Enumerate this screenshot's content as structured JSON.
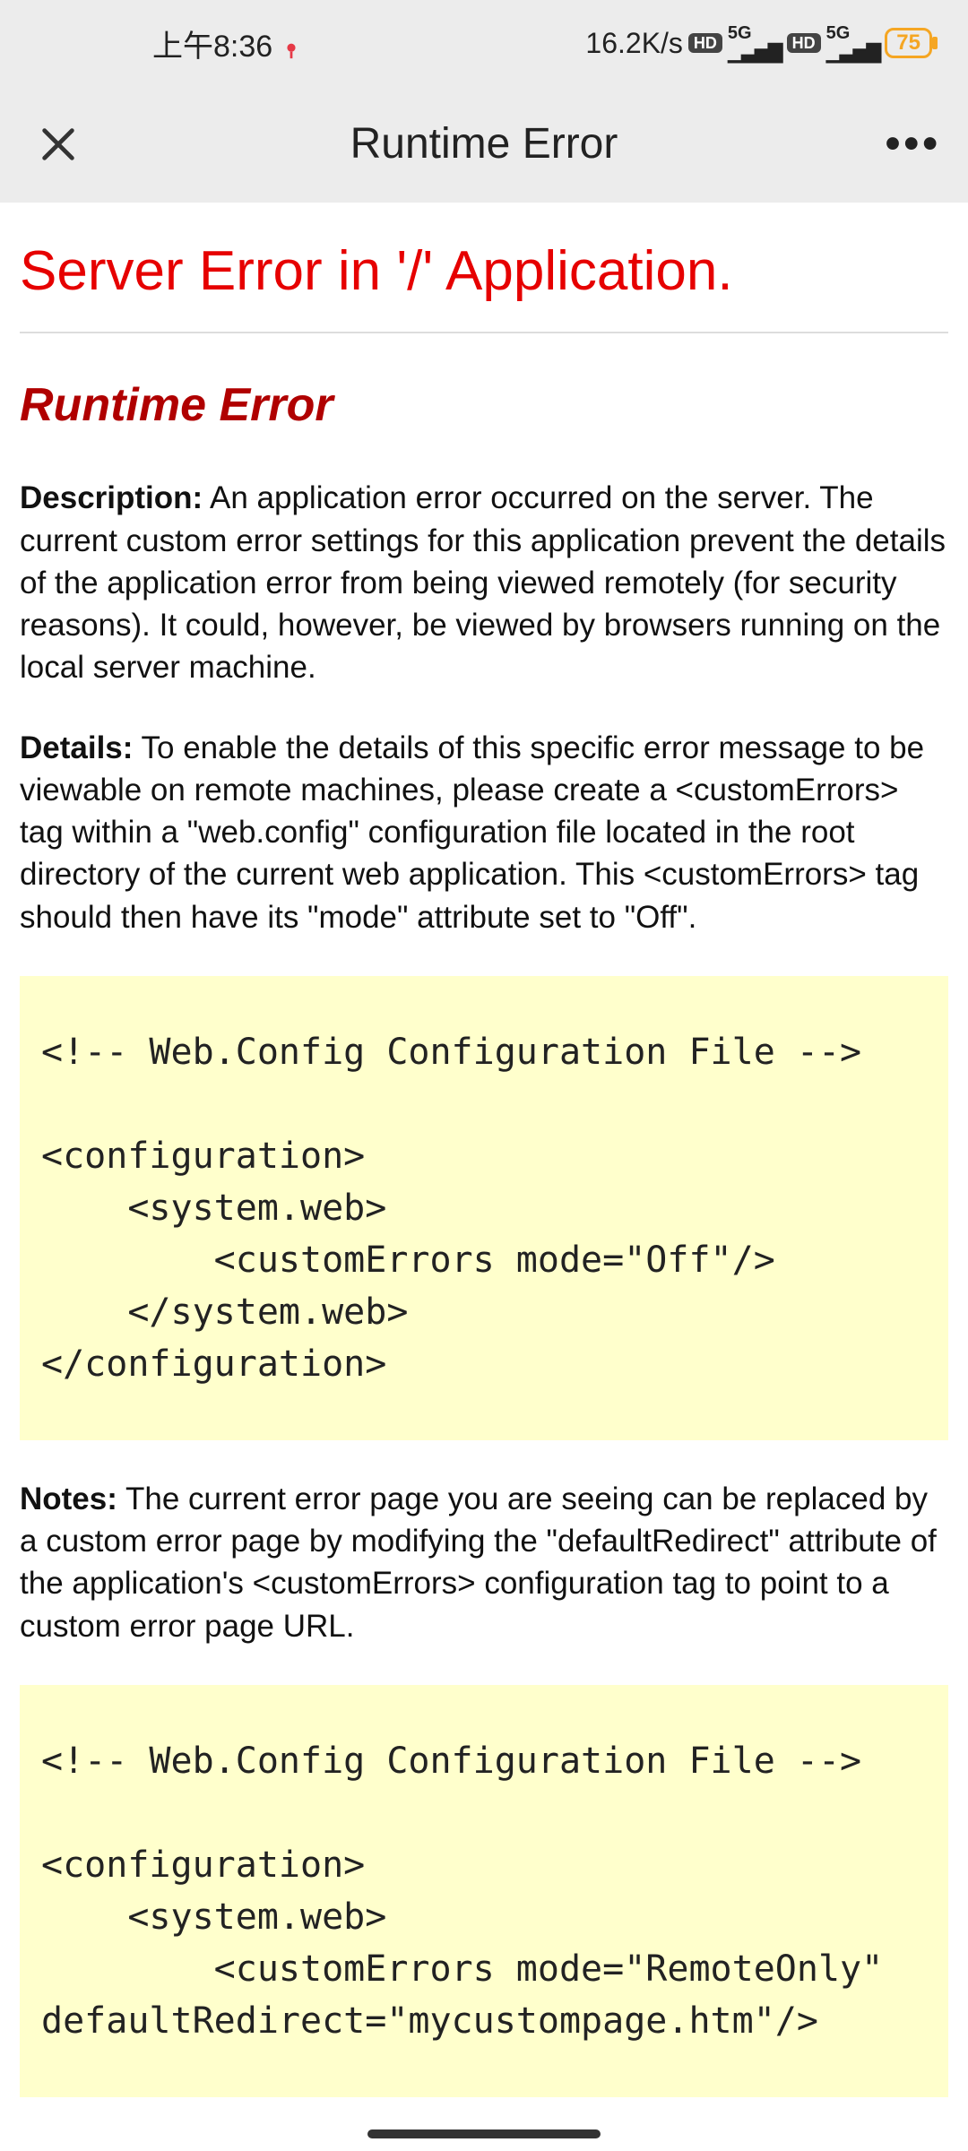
{
  "statusbar": {
    "time": "上午8:36",
    "speed": "16.2K/s",
    "hd1": "HD",
    "net1_top": "5G",
    "hd2": "HD",
    "net2_top": "5G",
    "battery": "75"
  },
  "titlebar": {
    "title": "Runtime Error"
  },
  "page": {
    "server_error": "Server Error in '/' Application.",
    "runtime_heading": "Runtime Error",
    "desc_label": "Description:",
    "desc_text": " An application error occurred on the server. The current custom error settings for this application prevent the details of the application error from being viewed remotely (for security reasons). It could, however, be viewed by browsers running on the local server machine.",
    "details_label": "Details:",
    "details_text": " To enable the details of this specific error message to be viewable on remote machines, please create a <customErrors> tag within a \"web.config\" configuration file located in the root directory of the current web application. This <customErrors> tag should then have its \"mode\" attribute set to \"Off\".",
    "code1": "<!-- Web.Config Configuration File -->\n\n<configuration>\n    <system.web>\n        <customErrors mode=\"Off\"/>\n    </system.web>\n</configuration>",
    "notes_label": "Notes:",
    "notes_text": " The current error page you are seeing can be replaced by a custom error page by modifying the \"defaultRedirect\" attribute of the application's <customErrors> configuration tag to point to a custom error page URL.",
    "code2": "<!-- Web.Config Configuration File -->\n\n<configuration>\n    <system.web>\n        <customErrors mode=\"RemoteOnly\" defaultRedirect=\"mycustompage.htm\"/>"
  }
}
